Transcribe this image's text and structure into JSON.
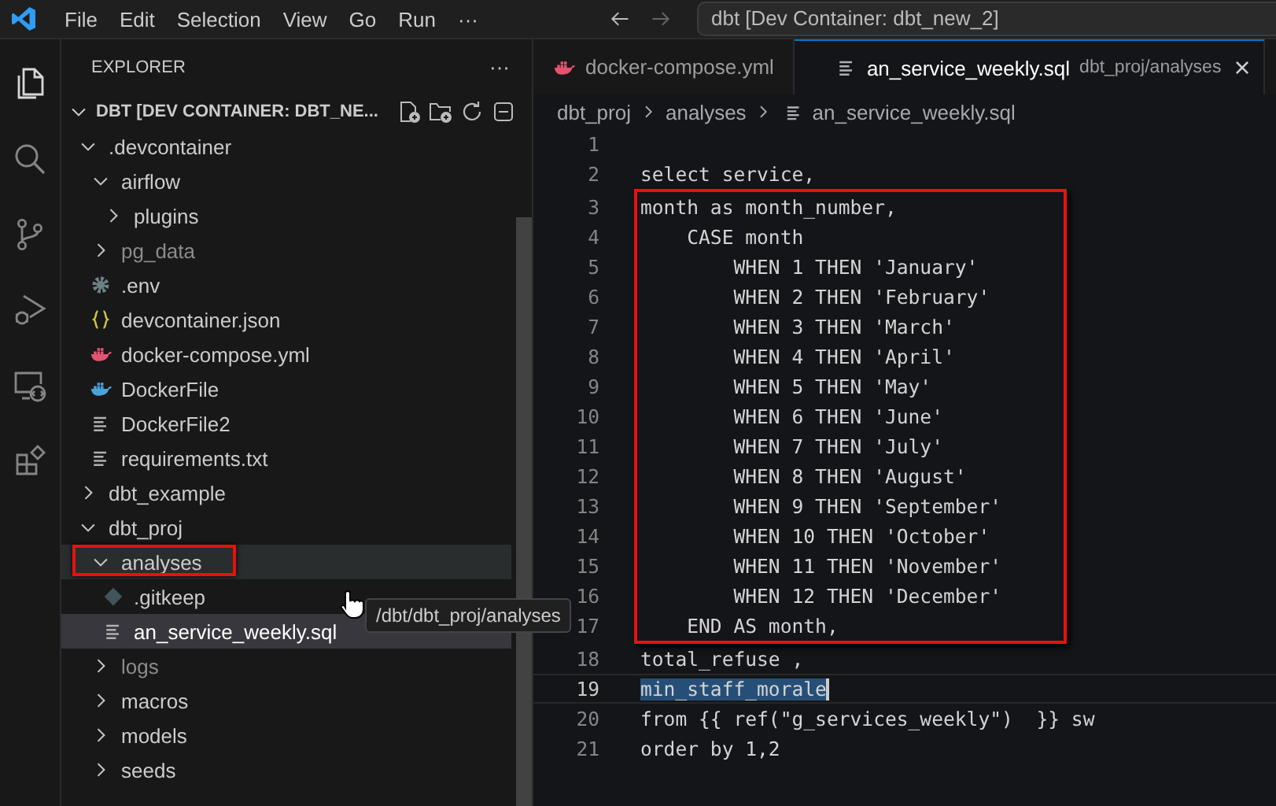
{
  "menu": [
    "File",
    "Edit",
    "Selection",
    "View",
    "Go",
    "Run",
    "···"
  ],
  "command_center": "dbt [Dev Container: dbt_new_2]",
  "activity_bar": [
    {
      "kind": "files",
      "selected": true
    },
    {
      "kind": "search",
      "selected": false
    },
    {
      "kind": "source-control",
      "selected": false
    },
    {
      "kind": "run-debug",
      "selected": false
    },
    {
      "kind": "remote",
      "selected": false
    },
    {
      "kind": "extensions",
      "selected": false
    }
  ],
  "sidebar": {
    "title": "EXPLORER",
    "more": "···",
    "root": {
      "label": "DBT [DEV CONTAINER: DBT_NE...",
      "expanded": true
    },
    "tree": [
      {
        "label": ".devcontainer",
        "kind": "folder",
        "expanded": true,
        "ignored": false,
        "selected": false,
        "hovered": false,
        "boxed": false,
        "children": [
          {
            "label": "airflow",
            "kind": "folder",
            "expanded": true,
            "ignored": false,
            "selected": false,
            "hovered": false,
            "boxed": false,
            "children": [
              {
                "label": "plugins",
                "kind": "folder",
                "expanded": false,
                "ignored": false,
                "selected": false,
                "hovered": false,
                "boxed": false
              }
            ]
          },
          {
            "label": "pg_data",
            "kind": "folder",
            "expanded": false,
            "ignored": true,
            "selected": false,
            "hovered": false,
            "boxed": false
          },
          {
            "label": ".env",
            "kind": "env",
            "ignored": false,
            "selected": false,
            "hovered": false,
            "boxed": false
          },
          {
            "label": "devcontainer.json",
            "kind": "json",
            "ignored": false,
            "selected": false,
            "hovered": false,
            "boxed": false
          },
          {
            "label": "docker-compose.yml",
            "kind": "compose",
            "ignored": false,
            "selected": false,
            "hovered": false,
            "boxed": false
          },
          {
            "label": "DockerFile",
            "kind": "docker",
            "ignored": false,
            "selected": false,
            "hovered": false,
            "boxed": false
          },
          {
            "label": "DockerFile2",
            "kind": "text",
            "ignored": false,
            "selected": false,
            "hovered": false,
            "boxed": false
          },
          {
            "label": "requirements.txt",
            "kind": "text",
            "ignored": false,
            "selected": false,
            "hovered": false,
            "boxed": false
          }
        ]
      },
      {
        "label": "dbt_example",
        "kind": "folder",
        "expanded": false,
        "ignored": false,
        "selected": false,
        "hovered": false,
        "boxed": false
      },
      {
        "label": "dbt_proj",
        "kind": "folder",
        "expanded": true,
        "ignored": false,
        "selected": false,
        "hovered": false,
        "boxed": false,
        "children": [
          {
            "label": "analyses",
            "kind": "folder",
            "expanded": true,
            "ignored": false,
            "selected": false,
            "hovered": true,
            "boxed": true,
            "children": [
              {
                "label": ".gitkeep",
                "kind": "gitkeep",
                "ignored": false,
                "selected": false,
                "hovered": false,
                "boxed": false
              },
              {
                "label": "an_service_weekly.sql",
                "kind": "text",
                "ignored": false,
                "selected": true,
                "hovered": false,
                "boxed": false
              }
            ]
          },
          {
            "label": "logs",
            "kind": "folder",
            "expanded": false,
            "ignored": true,
            "selected": false,
            "hovered": false,
            "boxed": false
          },
          {
            "label": "macros",
            "kind": "folder",
            "expanded": false,
            "ignored": false,
            "selected": false,
            "hovered": false,
            "boxed": false
          },
          {
            "label": "models",
            "kind": "folder",
            "expanded": false,
            "ignored": false,
            "selected": false,
            "hovered": false,
            "boxed": false
          },
          {
            "label": "seeds",
            "kind": "folder",
            "expanded": false,
            "ignored": false,
            "selected": false,
            "hovered": false,
            "boxed": false
          }
        ]
      }
    ]
  },
  "tooltip": "/dbt/dbt_proj/analyses",
  "tabs": [
    {
      "label": "docker-compose.yml",
      "kind": "compose",
      "selected": false
    },
    {
      "label": "an_service_weekly.sql",
      "kind": "text",
      "description": "dbt_proj/analyses",
      "close": "×",
      "selected": true
    }
  ],
  "breadcrumbs": [
    "dbt_proj",
    "analyses",
    "an_service_weekly.sql"
  ],
  "code": [
    {
      "number": "1",
      "boxed": false,
      "current": false
    },
    {
      "number": "2",
      "text": "select service,",
      "boxed": false,
      "current": false
    },
    {
      "number": "3",
      "text": "month as month_number,",
      "boxed": true,
      "current": false
    },
    {
      "number": "4",
      "text": "    CASE month",
      "boxed": true,
      "current": false
    },
    {
      "number": "5",
      "text": "        WHEN 1 THEN 'January'",
      "boxed": true,
      "current": false
    },
    {
      "number": "6",
      "text": "        WHEN 2 THEN 'February'",
      "boxed": true,
      "current": false
    },
    {
      "number": "7",
      "text": "        WHEN 3 THEN 'March'",
      "boxed": true,
      "current": false
    },
    {
      "number": "8",
      "text": "        WHEN 4 THEN 'April'",
      "boxed": true,
      "current": false
    },
    {
      "number": "9",
      "text": "        WHEN 5 THEN 'May'",
      "boxed": true,
      "current": false
    },
    {
      "number": "10",
      "text": "        WHEN 6 THEN 'June'",
      "boxed": true,
      "current": false
    },
    {
      "number": "11",
      "text": "        WHEN 7 THEN 'July'",
      "boxed": true,
      "current": false
    },
    {
      "number": "12",
      "text": "        WHEN 8 THEN 'August'",
      "boxed": true,
      "current": false
    },
    {
      "number": "13",
      "text": "        WHEN 9 THEN 'September'",
      "boxed": true,
      "current": false
    },
    {
      "number": "14",
      "text": "        WHEN 10 THEN 'October'",
      "boxed": true,
      "current": false
    },
    {
      "number": "15",
      "text": "        WHEN 11 THEN 'November'",
      "boxed": true,
      "current": false
    },
    {
      "number": "16",
      "text": "        WHEN 12 THEN 'December'",
      "boxed": true,
      "current": false
    },
    {
      "number": "17",
      "text": "    END AS month,",
      "boxed": true,
      "current": false
    },
    {
      "number": "18",
      "text": "total_refuse ,",
      "boxed": false,
      "current": false
    },
    {
      "number": "19",
      "text": "min_staff_morale",
      "boxed": false,
      "current": true
    },
    {
      "number": "20",
      "text": "from {{ ref(\"g_services_weekly\")  }} sw",
      "boxed": false,
      "current": false
    },
    {
      "number": "21",
      "text": "order by 1,2",
      "boxed": false,
      "current": false
    }
  ]
}
